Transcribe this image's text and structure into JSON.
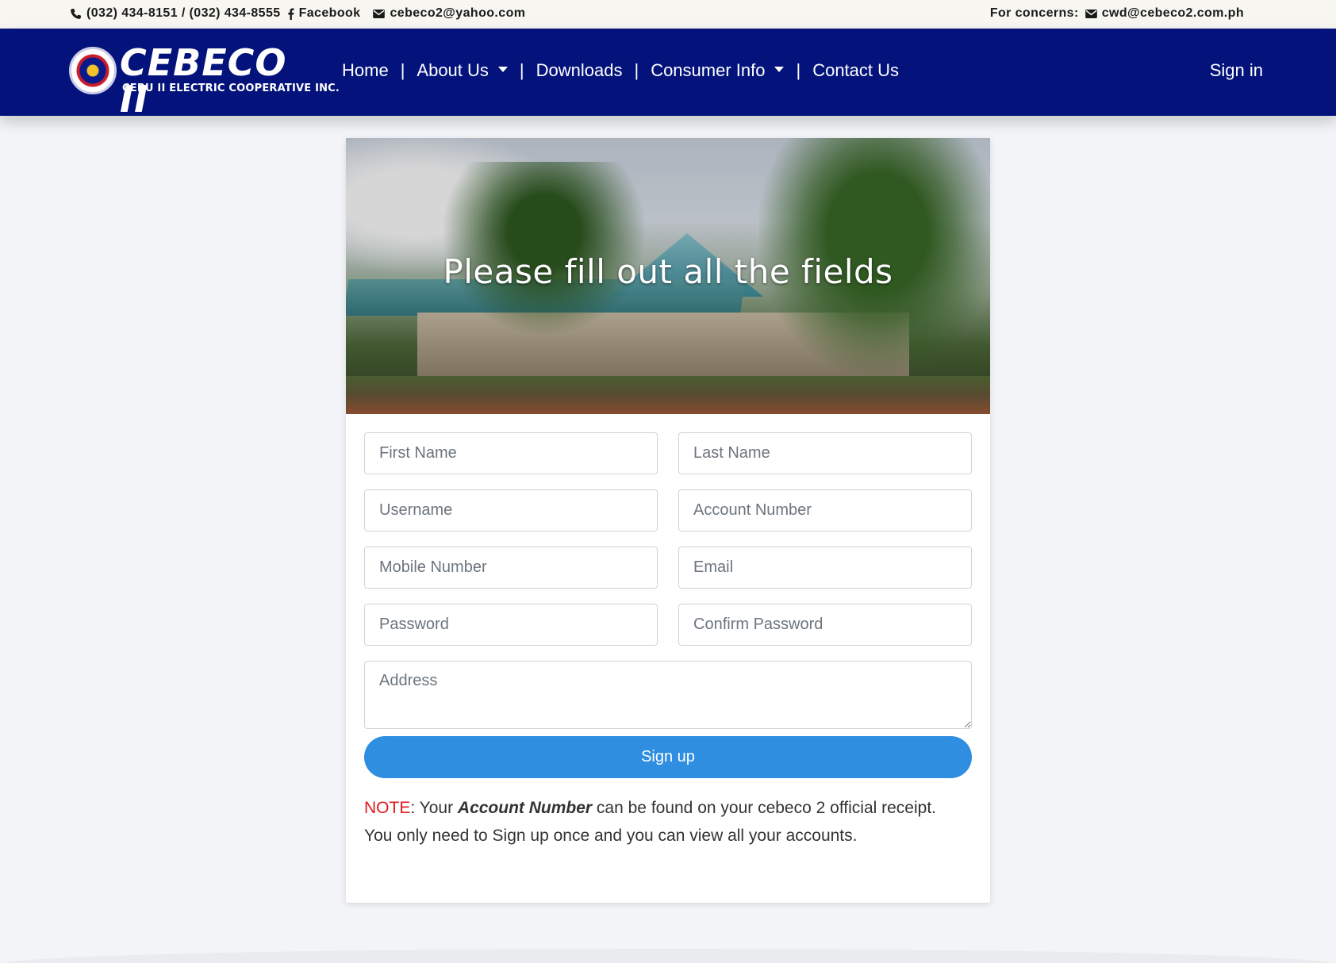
{
  "topbar": {
    "phones": "(032) 434-8151 / (032) 434-8555",
    "facebook": "Facebook",
    "email": "cebeco2@yahoo.com",
    "concerns_label": "For concerns:",
    "concerns_email": "cwd@cebeco2.com.ph",
    "icons": [
      "phone-icon",
      "facebook-icon",
      "envelope-icon"
    ]
  },
  "brand": {
    "name": "CEBECO II",
    "tagline": "CEBU II ELECTRIC COOPERATIVE INC."
  },
  "nav": {
    "home": "Home",
    "about": "About Us",
    "downloads": "Downloads",
    "consumer_info": "Consumer Info",
    "contact": "Contact Us",
    "separator": "|",
    "signin": "Sign in"
  },
  "hero": {
    "title": "Please fill out all the fields"
  },
  "form": {
    "first_name": "First Name",
    "last_name": "Last Name",
    "username": "Username",
    "account_number": "Account Number",
    "mobile_number": "Mobile Number",
    "email": "Email",
    "password": "Password",
    "confirm_password": "Confirm Password",
    "address": "Address",
    "submit": "Sign up"
  },
  "note": {
    "label": "NOTE",
    "text1": ": Your ",
    "emphasis": "Account Number",
    "text2": " can be found on your cebeco 2 official receipt.",
    "text3": "You only need to Sign up once and you can view all your accounts."
  },
  "colors": {
    "navbar": "#04137b",
    "button": "#2f8ee0",
    "note_label": "#e0181e",
    "background": "#f2f4f7"
  }
}
